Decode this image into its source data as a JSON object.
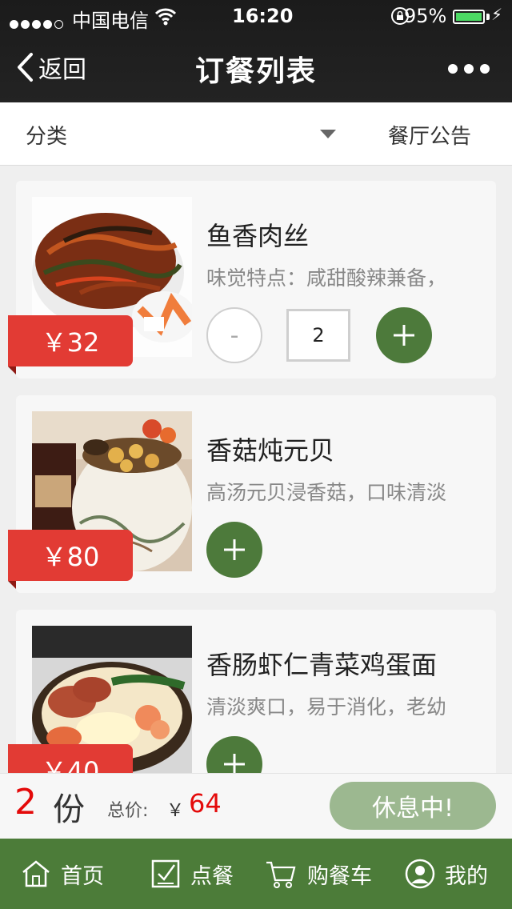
{
  "status_bar": {
    "carrier": "中国电信",
    "time": "16:20",
    "battery": "95%"
  },
  "nav": {
    "back_label": "返回",
    "title": "订餐列表"
  },
  "filter": {
    "category_label": "分类",
    "notice_label": "餐厅公告"
  },
  "dishes": [
    {
      "name": "鱼香肉丝",
      "desc": "味觉特点：咸甜酸辣兼备，",
      "price": "￥32",
      "quantity": "2",
      "minus_label": "-"
    },
    {
      "name": "香菇炖元贝",
      "desc": "高汤元贝浸香菇，口味清淡",
      "price": "￥80"
    },
    {
      "name": "香肠虾仁青菜鸡蛋面",
      "desc": "清淡爽口，易于消化，老幼",
      "price": "￥40"
    }
  ],
  "summary": {
    "count": "2",
    "count_unit": "份",
    "total_label": "总价:",
    "currency": "￥",
    "total_value": "64",
    "status_button": "休息中!"
  },
  "tabs": [
    {
      "label": "首页",
      "icon": "home-icon"
    },
    {
      "label": "点餐",
      "icon": "order-icon"
    },
    {
      "label": "购餐车",
      "icon": "cart-icon"
    },
    {
      "label": "我的",
      "icon": "user-icon"
    }
  ],
  "colors": {
    "accent_green": "#4c7c39",
    "price_red": "#e23b34",
    "battery_green": "#4cd964"
  }
}
